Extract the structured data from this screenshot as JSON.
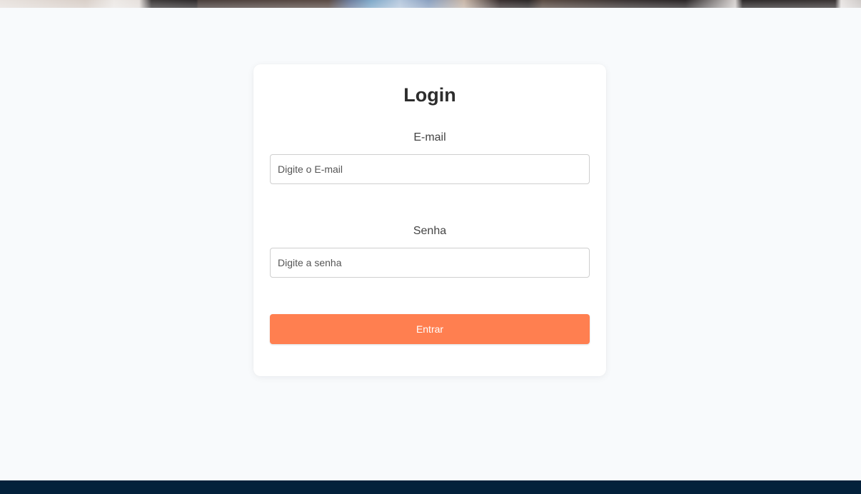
{
  "login": {
    "title": "Login",
    "email_label": "E-mail",
    "email_placeholder": "Digite o E-mail",
    "email_value": "",
    "password_label": "Senha",
    "password_placeholder": "Digite a senha",
    "password_value": "",
    "submit_label": "Entrar"
  },
  "colors": {
    "page_background": "#f8fafc",
    "card_background": "#ffffff",
    "button_accent": "#ff7f50",
    "footer_background": "#03213b"
  }
}
